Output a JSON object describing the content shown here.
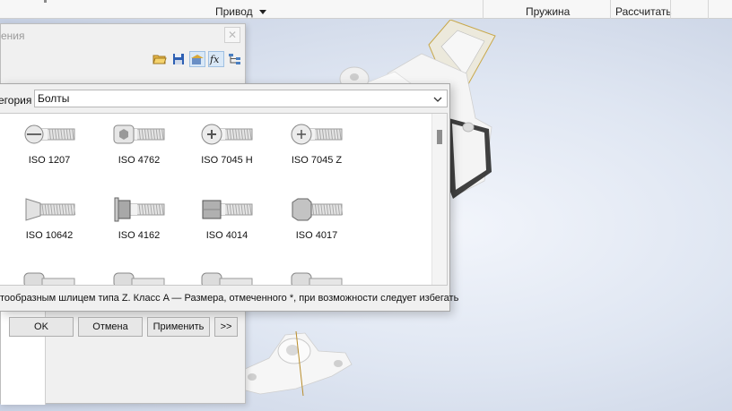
{
  "ribbon": {
    "drive_label": "Привод",
    "spring_label": "Пружина",
    "calculate_label": "Рассчитать"
  },
  "bg_dialog": {
    "title_fragment": "ения",
    "close_glyph": "✕"
  },
  "dialog": {
    "category_label": "егория",
    "category_value": "Болты",
    "items": [
      {
        "label": "ISO 1207",
        "icon": "slotted-cheese-head-bolt-icon"
      },
      {
        "label": "ISO 4762",
        "icon": "socket-head-cap-screw-icon"
      },
      {
        "label": "ISO 7045 H",
        "icon": "pan-head-cross-recess-h-icon"
      },
      {
        "label": "ISO 7045 Z",
        "icon": "pan-head-cross-recess-z-icon"
      },
      {
        "label": "ISO 10642",
        "icon": "countersunk-socket-screw-icon"
      },
      {
        "label": "ISO 4162",
        "icon": "hex-flange-bolt-icon"
      },
      {
        "label": "ISO 4014",
        "icon": "hex-bolt-partial-thread-icon"
      },
      {
        "label": "ISO 4017",
        "icon": "hex-bolt-full-thread-icon"
      }
    ],
    "description": "тообразным шлицем типа Z. Класс A — Размера, отмеченного *, при возможности следует избегать",
    "buttons": {
      "ok": "OK",
      "cancel": "Отмена",
      "apply": "Применить",
      "more": ">>"
    }
  },
  "colors": {
    "viewport_bg": "#dfe6f2",
    "part_color": "#f4f4f4",
    "axis_line": "#c8a84a"
  }
}
